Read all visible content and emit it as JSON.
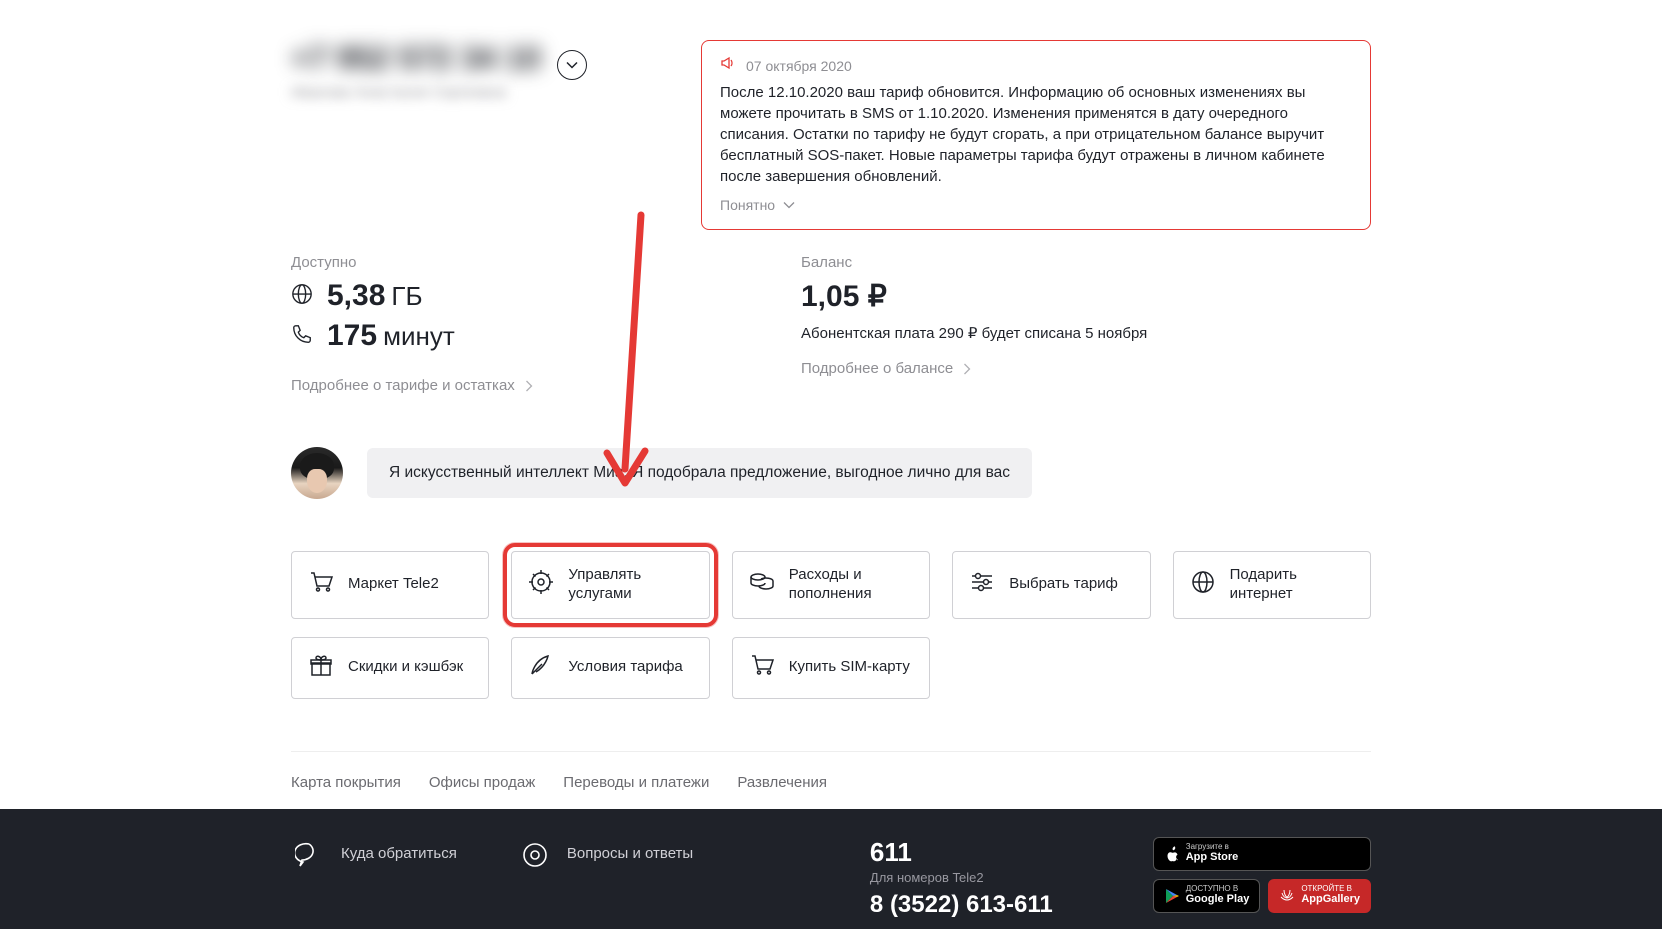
{
  "userHeader": {
    "phone": "+7 952 572 34 10",
    "owner": "Иванова Анастасия Сергеевна"
  },
  "notice": {
    "date": "07 октября 2020",
    "text": "После 12.10.2020 ваш тариф обновится. Информацию об основных изменениях вы можете прочитать в SMS от 1.10.2020. Изменения применятся в дату очередного списания. Остатки по тарифу не будут сгорать, а при отрицательном балансе выручит бесплатный SOS-пакет. Новые параметры тарифа будут отражены в личном кабинете после завершения обновлений.",
    "dismiss": "Понятно"
  },
  "remain": {
    "label": "Доступно",
    "data": {
      "value": "5,38",
      "unit": "ГБ"
    },
    "minutes": {
      "value": "175",
      "unit": "минут"
    },
    "more": "Подробнее о тарифе и остатках"
  },
  "balance": {
    "label": "Баланс",
    "value": "1,05 ₽",
    "note": "Абонентская плата 290 ₽ будет списана 5 ноября",
    "more": "Подробнее о балансе"
  },
  "mia": {
    "text": "Я искусственный интеллект Миа. Я подобрала предложение, выгодное лично для вас"
  },
  "tiles": {
    "market": "Маркет Tele2",
    "services": "Управлять услугами",
    "expenses": "Расходы и пополнения",
    "tariff": "Выбрать тариф",
    "gift": "Подарить интернет",
    "cashback": "Скидки и кэшбэк",
    "conditions": "Условия тарифа",
    "sim": "Купить SIM-карту"
  },
  "subLinks": {
    "coverage": "Карта покрытия",
    "offices": "Офисы продаж",
    "payments": "Переводы и платежи",
    "fun": "Развлечения"
  },
  "footer": {
    "contact": "Куда обратиться",
    "faq": "Вопросы и ответы",
    "shortNum": "611",
    "shortSub": "Для номеров Tele2",
    "fullNum": "8 (3522) 613-611",
    "appstore": {
      "top": "Загрузите в",
      "main": "App Store"
    },
    "gplay": {
      "top": "ДОСТУПНО В",
      "main": "Google Play"
    },
    "huawei": {
      "top": "ОТКРОЙТЕ В",
      "main": "AppGallery"
    }
  }
}
